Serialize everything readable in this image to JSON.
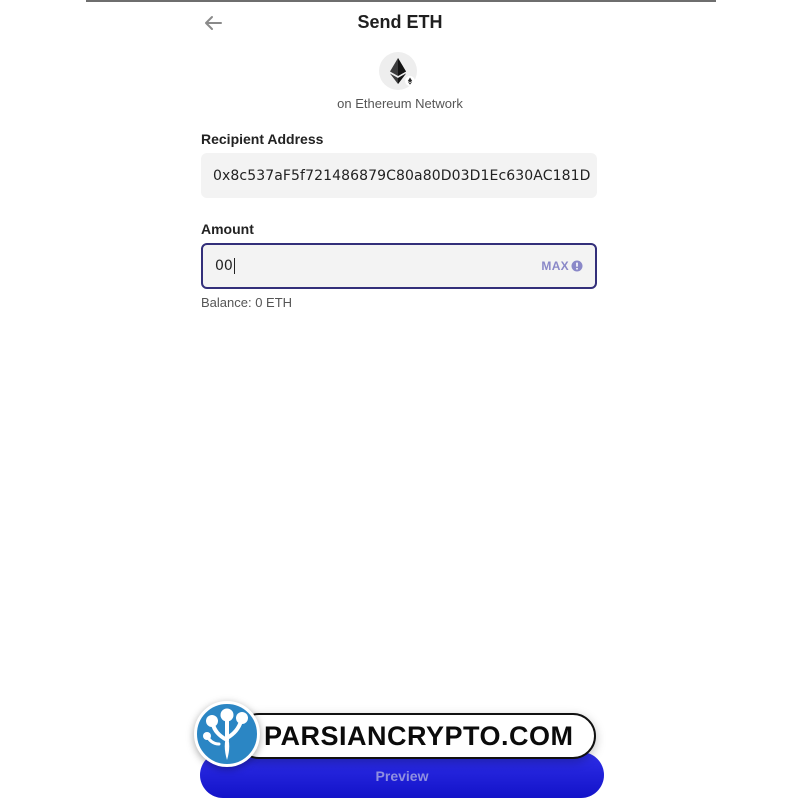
{
  "header": {
    "title": "Send ETH",
    "back_icon": "arrow-left-icon"
  },
  "asset": {
    "icon": "ethereum-icon",
    "network_label": "on Ethereum Network"
  },
  "recipient": {
    "label": "Recipient Address",
    "value": "0x8c537aF5f721486879C80a80D03D1Ec630AC181D"
  },
  "amount": {
    "label": "Amount",
    "value": "00",
    "max_label": "MAX",
    "info_icon": "info-circle-icon"
  },
  "balance": {
    "text": "Balance: 0 ETH"
  },
  "actions": {
    "preview_label": "Preview"
  },
  "watermark": {
    "text": "PARSIANCRYPTO.COM"
  },
  "colors": {
    "accent": "#332f7a",
    "max": "#8a88c8",
    "button": "#1f1fd6"
  }
}
